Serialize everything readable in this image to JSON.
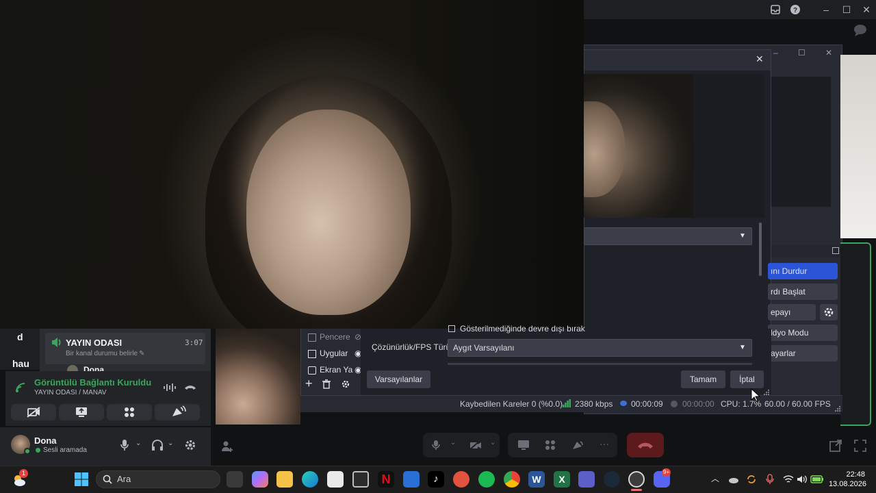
{
  "discord": {
    "server_letters": [
      "d",
      "hau"
    ],
    "channel": {
      "name": "YAYIN ODASI",
      "duration": "3:07",
      "status_placeholder": "Bir kanal durumu belirle",
      "member": "Dona"
    },
    "voice": {
      "status": "Görüntülü Bağlantı Kuruldu",
      "location": "YAYIN ODASI / MANAV"
    },
    "user": {
      "name": "Dona",
      "status": "Sesli aramada"
    },
    "colors": {
      "green": "#3ba55c",
      "hangup": "#da373c",
      "blurple": "#5865f2"
    }
  },
  "obs": {
    "sources": [
      {
        "label": "Pencere",
        "visible": false
      },
      {
        "label": "Uygular",
        "visible": true
      },
      {
        "label": "Ekran Ya",
        "visible": true
      }
    ],
    "form": {
      "checkbox_label": "Gösterilmediğinde devre dışı bırak",
      "resolution_label": "Çözünürlük/FPS Türü",
      "resolution_value": "Aygıt Varsayılanı"
    },
    "buttons": {
      "defaults": "Varsayılanlar",
      "ok": "Tamam",
      "cancel": "İptal"
    },
    "controls": [
      "ını Durdur",
      "rdı Başlat",
      "ерayı Başlat",
      "ldyo Modu",
      "ayarlar"
    ],
    "status": {
      "dropped_frames": "Kaybedilen Kareler 0 (%0.0)",
      "bitrate": "2380 kbps",
      "stream_time": "00:00:09",
      "rec_time": "00:00:00",
      "cpu": "CPU: 1.7%",
      "fps": "60.00 / 60.00 FPS"
    },
    "accent": "#2b55d6"
  },
  "taskbar": {
    "search_placeholder": "Ara",
    "time": "22:48",
    "date": "13.08.2026",
    "weather_badge": "1",
    "discord_badge": "9+"
  }
}
